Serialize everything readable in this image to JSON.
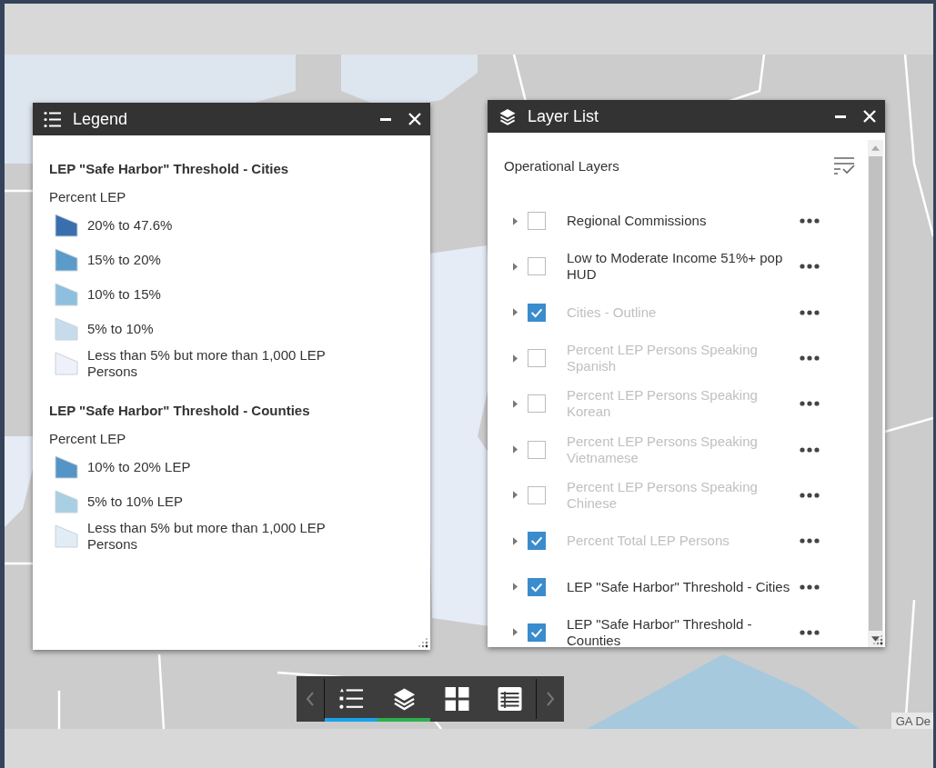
{
  "legend_panel": {
    "title": "Legend",
    "layers": [
      {
        "title": "LEP \"Safe Harbor\" Threshold - Cities",
        "field": "Percent LEP",
        "classes": [
          {
            "label": "20% to 47.6%",
            "color": "#3a6fae"
          },
          {
            "label": "15% to 20%",
            "color": "#5b9bc9"
          },
          {
            "label": "10% to 15%",
            "color": "#8ebfde"
          },
          {
            "label": "5% to 10%",
            "color": "#c6dcea"
          },
          {
            "label": "Less than 5% but more than 1,000 LEP Persons",
            "color": "#eef1fb"
          }
        ]
      },
      {
        "title": "LEP \"Safe Harbor\" Threshold - Counties",
        "field": "Percent LEP",
        "classes": [
          {
            "label": "10% to 20% LEP",
            "color": "#5594c6"
          },
          {
            "label": "5% to 10% LEP",
            "color": "#a9cfe3"
          },
          {
            "label": "Less than 5% but more than 1,000 LEP Persons",
            "color": "#e2ecf5"
          }
        ]
      }
    ]
  },
  "layer_list_panel": {
    "title": "Layer List",
    "heading": "Operational Layers",
    "layers": [
      {
        "name": "Regional Commissions",
        "checked": false,
        "disabled": false
      },
      {
        "name": "Low to Moderate Income 51%+ pop HUD",
        "checked": false,
        "disabled": false
      },
      {
        "name": "Cities - Outline",
        "checked": true,
        "disabled": true
      },
      {
        "name": "Percent LEP Persons Speaking Spanish",
        "checked": false,
        "disabled": true
      },
      {
        "name": "Percent LEP Persons Speaking Korean",
        "checked": false,
        "disabled": true
      },
      {
        "name": "Percent LEP Persons Speaking Vietnamese",
        "checked": false,
        "disabled": true
      },
      {
        "name": "Percent LEP Persons Speaking Chinese",
        "checked": false,
        "disabled": true
      },
      {
        "name": "Percent Total LEP Persons",
        "checked": true,
        "disabled": true
      },
      {
        "name": "LEP \"Safe Harbor\" Threshold - Cities",
        "checked": true,
        "disabled": false
      },
      {
        "name": "LEP \"Safe Harbor\" Threshold - Counties",
        "checked": true,
        "disabled": false
      }
    ]
  },
  "toolbar": {
    "buttons": [
      {
        "kind": "legend",
        "open": true,
        "color": "#1aa3e8"
      },
      {
        "kind": "layers",
        "open": true,
        "color": "#2fae4e"
      },
      {
        "kind": "grid",
        "open": false
      },
      {
        "kind": "table",
        "open": false
      }
    ]
  },
  "attribution": "GA De"
}
